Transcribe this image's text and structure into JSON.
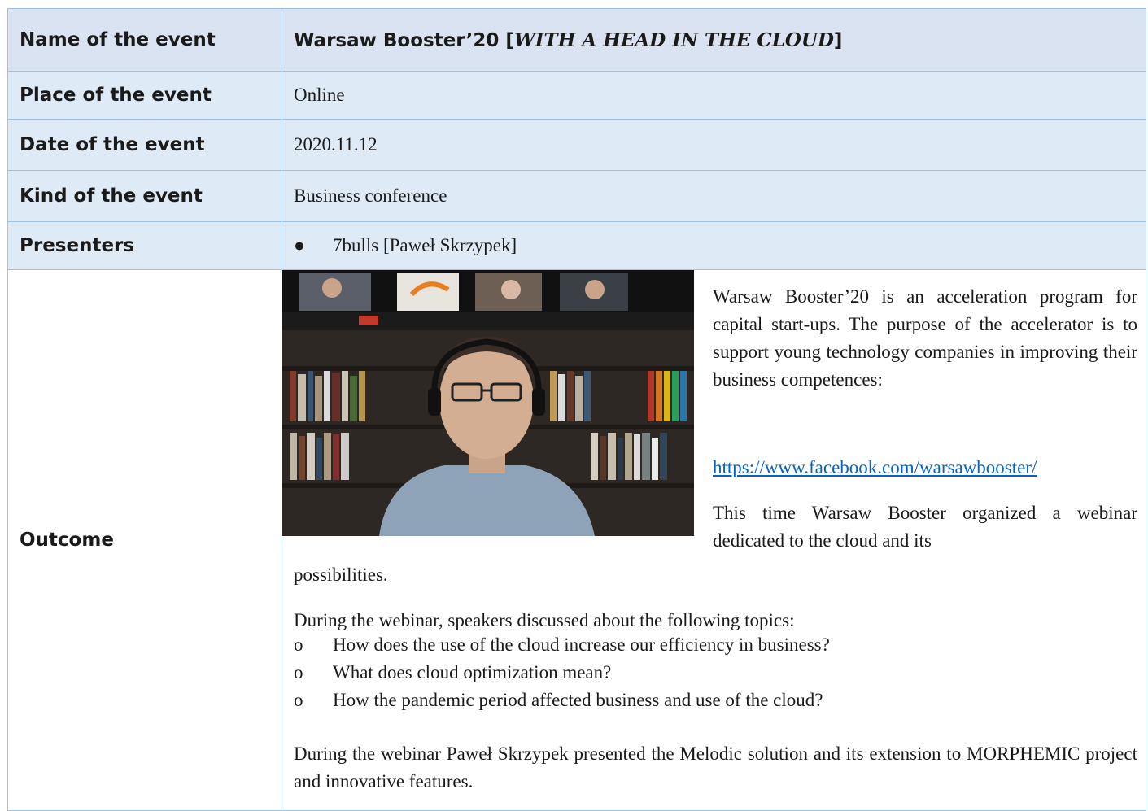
{
  "table": {
    "name_label": "Name of the event",
    "name_value_prefix": "Warsaw Booster’20 [",
    "name_value_italic": "WITH A HEAD IN THE CLOUD",
    "name_value_suffix": "]",
    "place_label": "Place of the event",
    "place_value": "Online",
    "date_label": "Date of the event",
    "date_value": "2020.11.12",
    "kind_label": "Kind of the event",
    "kind_value": "Business conference",
    "presenters_label": "Presenters",
    "presenters_bullet": "●",
    "presenters_value": "7bulls [Paweł Skrzypek]",
    "outcome_label": "Outcome"
  },
  "outcome": {
    "para1": "Warsaw Booster’20 is an acceleration program for capital start-ups. The purpose of the accelerator is to support young technology companies in improving their business competences:",
    "link": "https://www.facebook.com/warsawbooster/",
    "para2": "This time Warsaw Booster organized a webinar dedicated to the cloud and its",
    "para2_cont": "possibilities.",
    "topics_intro": "During the webinar, speakers discussed about the following topics:",
    "topic_marker": "o",
    "topics": [
      "How does the use of the cloud increase our efficiency in business?",
      "What does cloud optimization mean?",
      "How the pandemic period affected business and use of the cloud?"
    ],
    "closing": "During the webinar Paweł Skrzypek presented the Melodic solution and its extension to MORPHEMIC project and innovative features."
  },
  "colors": {
    "header_bg": "#dae3f2",
    "row_bg": "#deeaf6",
    "border": "#9cc3e6",
    "link": "#0563c1"
  }
}
